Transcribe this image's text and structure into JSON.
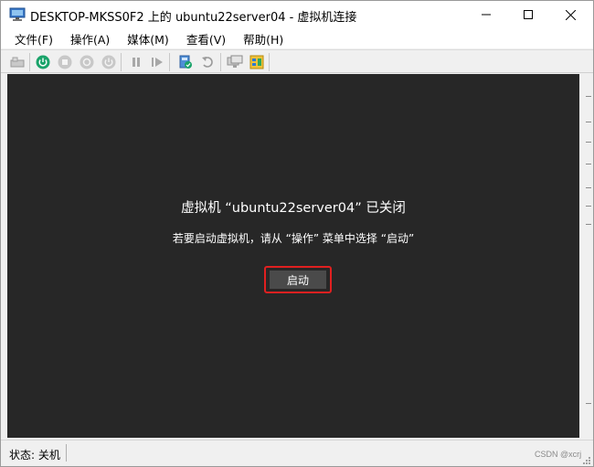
{
  "window": {
    "title": "DESKTOP-MKSS0F2 上的 ubuntu22server04 - 虚拟机连接"
  },
  "menu": {
    "items": [
      "文件(F)",
      "操作(A)",
      "媒体(M)",
      "查看(V)",
      "帮助(H)"
    ]
  },
  "toolbar": {
    "icons": [
      "ctrl-alt-del-icon",
      "power-on-icon",
      "stop-icon",
      "shutdown-icon",
      "power-off-icon",
      "pause-icon",
      "reset-icon",
      "checkpoint-icon",
      "revert-icon",
      "enhanced-session-icon",
      "share-icon"
    ],
    "accent": "#1aa36a"
  },
  "vm": {
    "message": "虚拟机 “ubuntu22server04” 已关闭",
    "hint": "若要启动虚拟机，请从 “操作” 菜单中选择 “启动”",
    "start_label": "启动",
    "highlight_color": "#e02020"
  },
  "status": {
    "text": "状态: 关机",
    "watermark": "CSDN @xcrj"
  }
}
